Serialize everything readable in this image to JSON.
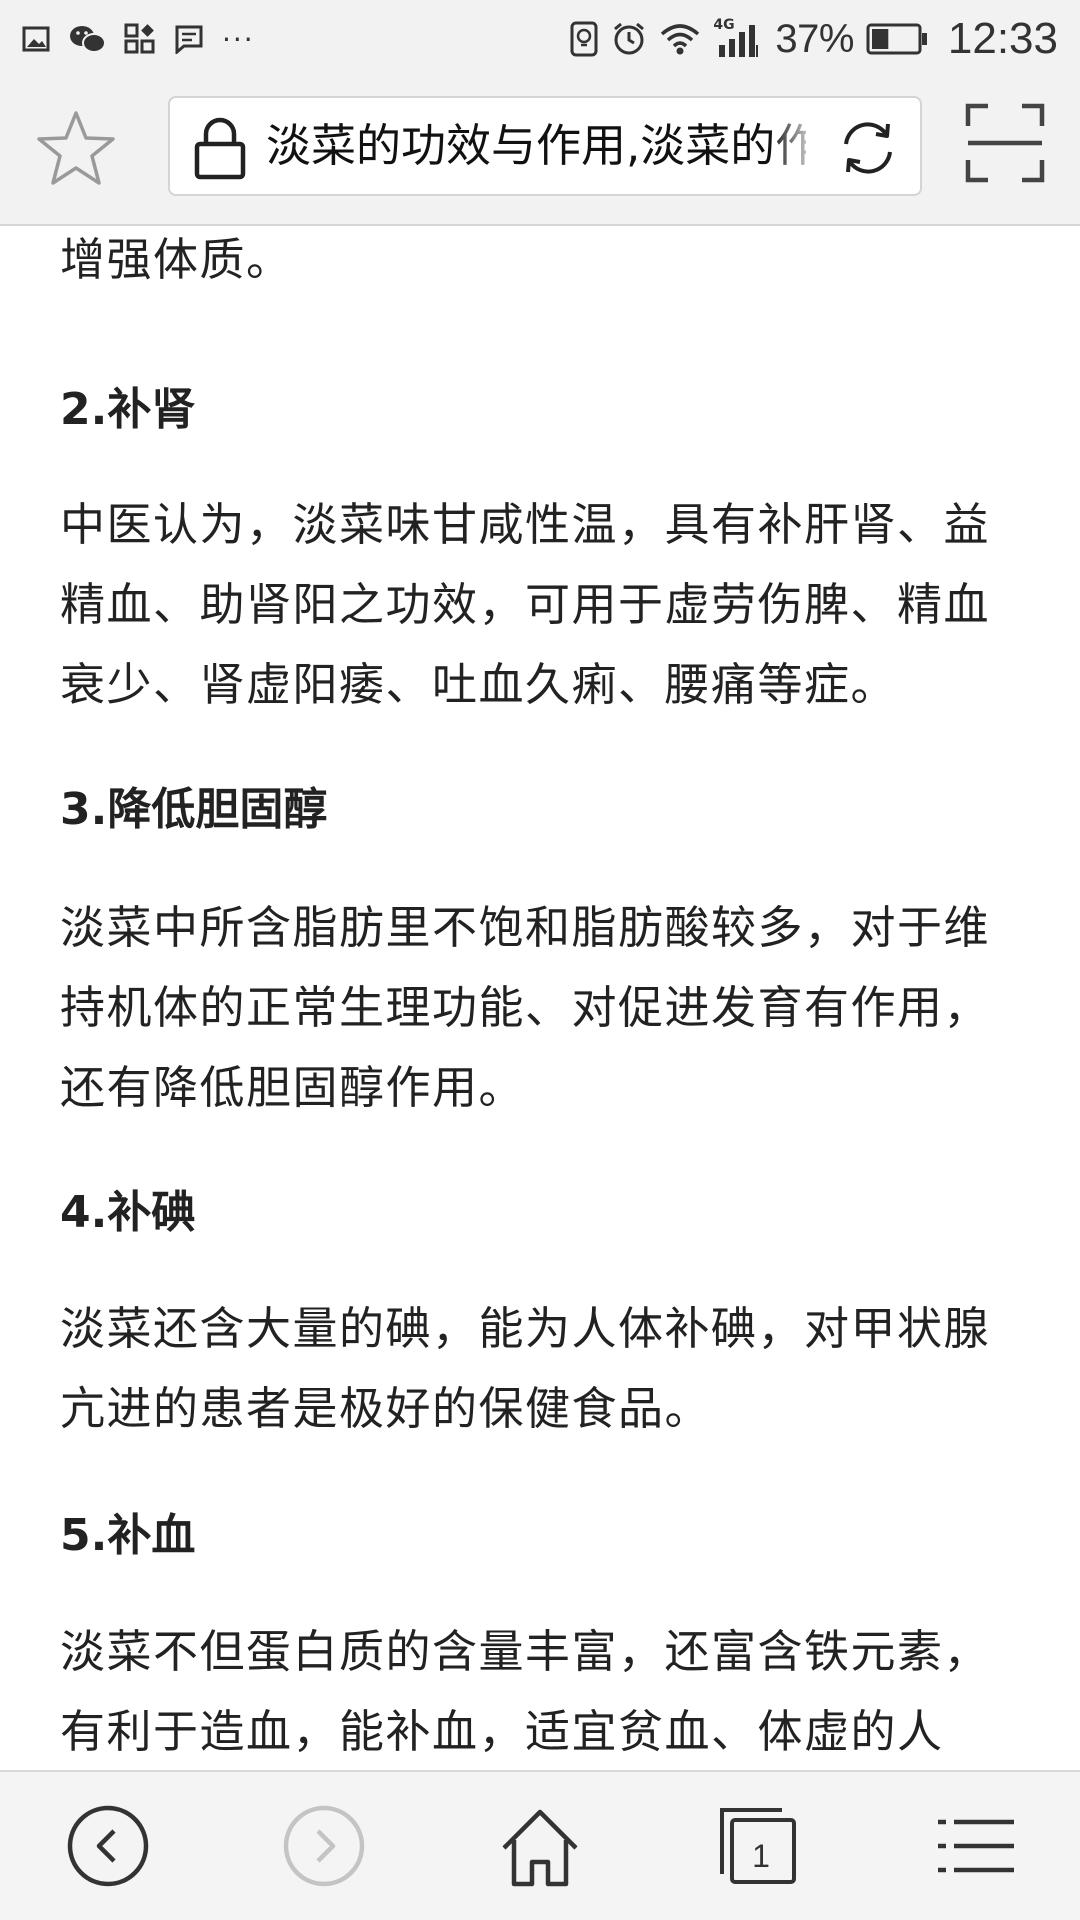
{
  "status_bar": {
    "left_icons": [
      "gallery-icon",
      "wechat-icon",
      "apps-icon",
      "message-icon",
      "more-dots-icon"
    ],
    "more_dots": "···",
    "right_icons": [
      "vibrate-icon",
      "alarm-icon",
      "wifi-icon",
      "signal-4g-icon",
      "battery-icon"
    ],
    "network_label": "4G",
    "battery_percent": "37%",
    "battery_level": 0.37,
    "time": "12:33"
  },
  "address_bar": {
    "url_title": "淡菜的功效与作用,淡菜的作",
    "icons": [
      "star-icon",
      "lock-icon",
      "refresh-icon",
      "scan-icon"
    ]
  },
  "article": {
    "lead_text": "增强体质。",
    "sections": [
      {
        "heading": "2.补肾",
        "body": "中医认为，淡菜味甘咸性温，具有补肝肾、益精血、助肾阳之功效，可用于虚劳伤脾、精血衰少、肾虚阳痿、吐血久痢、腰痛等症。"
      },
      {
        "heading": "3.降低胆固醇",
        "body": "淡菜中所含脂肪里不饱和脂肪酸较多，对于维持机体的正常生理功能、对促进发育有作用，还有降低胆固醇作用。"
      },
      {
        "heading": "4.补碘",
        "body": "淡菜还含大量的碘，能为人体补碘，对甲状腺亢进的患者是极好的保健食品。"
      },
      {
        "heading": "5.补血",
        "body": "淡菜不但蛋白质的含量丰富，还富含铁元素，有利于造血，能补血，适宜贫血、体虚的人"
      }
    ]
  },
  "toolbar": {
    "tab_count": "1",
    "icons": [
      "back-icon",
      "forward-icon",
      "home-icon",
      "tabs-icon",
      "menu-icon"
    ]
  },
  "colors": {
    "bar_background": "#f2f2f2",
    "text": "#222222",
    "icon": "#333333",
    "icon_disabled": "#bbbbbb"
  }
}
